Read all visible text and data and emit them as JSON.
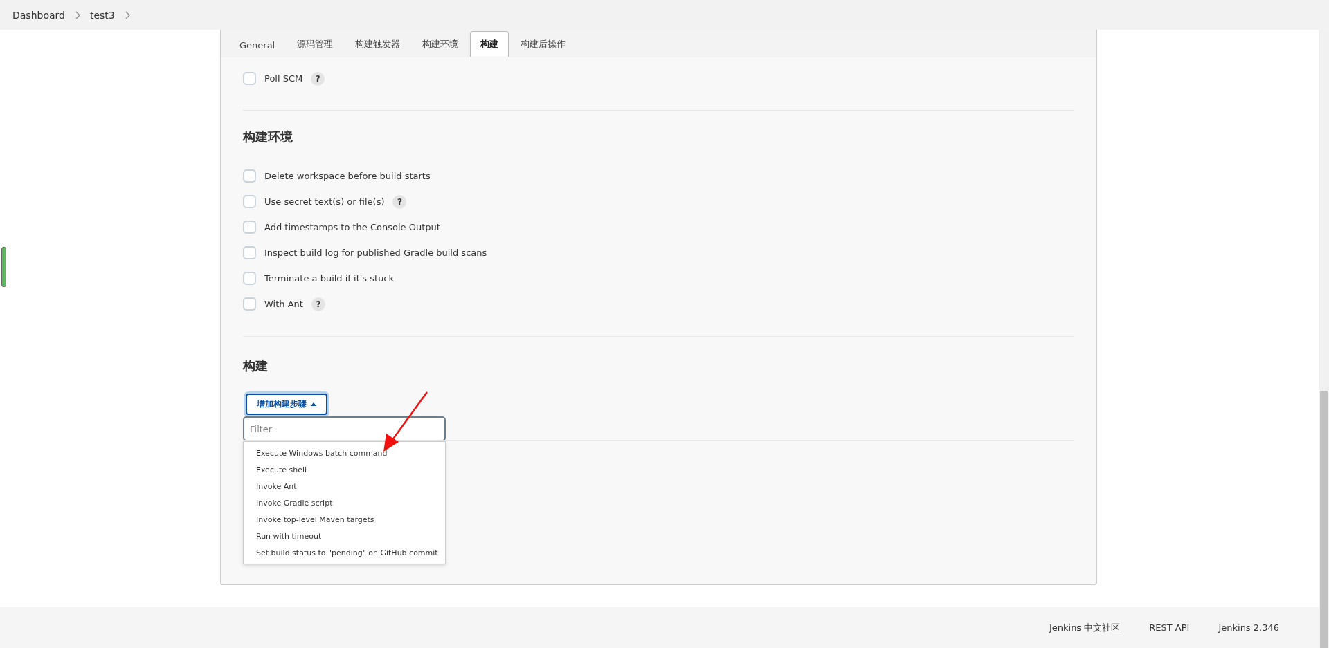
{
  "breadcrumbs": [
    "Dashboard",
    "test3"
  ],
  "tabs": [
    {
      "label": "General",
      "selected": false
    },
    {
      "label": "源码管理",
      "selected": false
    },
    {
      "label": "构建触发器",
      "selected": false
    },
    {
      "label": "构建环境",
      "selected": false
    },
    {
      "label": "构建",
      "selected": true
    },
    {
      "label": "构建后操作",
      "selected": false
    }
  ],
  "triggers": {
    "options": [
      {
        "label": "Poll SCM",
        "checked": false,
        "help": "?"
      }
    ]
  },
  "build_environment": {
    "title": "构建环境",
    "options": [
      {
        "label": "Delete workspace before build starts",
        "checked": false
      },
      {
        "label": "Use secret text(s) or file(s)",
        "checked": false,
        "help": "?"
      },
      {
        "label": "Add timestamps to the Console Output",
        "checked": false
      },
      {
        "label": "Inspect build log for published Gradle build scans",
        "checked": false
      },
      {
        "label": "Terminate a build if it's stuck",
        "checked": false
      },
      {
        "label": "With Ant",
        "checked": false,
        "help": "?"
      }
    ]
  },
  "build": {
    "title": "构建",
    "add_step_button": "增加构建步骤",
    "filter": {
      "placeholder": "Filter"
    },
    "menu_items": [
      "Execute Windows batch command",
      "Execute shell",
      "Invoke Ant",
      "Invoke Gradle script",
      "Invoke top-level Maven targets",
      "Run with timeout",
      "Set build status to \"pending\" on GitHub commit"
    ]
  },
  "footer_links": [
    "Jenkins 中文社区",
    "REST API",
    "Jenkins 2.346"
  ]
}
